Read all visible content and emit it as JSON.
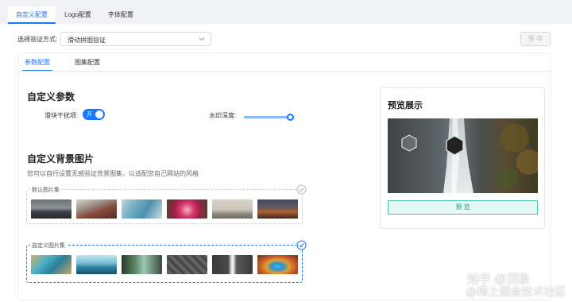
{
  "top_tabs": [
    {
      "label": "自定义配置",
      "active": true
    },
    {
      "label": "Logo配置",
      "active": false
    },
    {
      "label": "字体配置",
      "active": false
    }
  ],
  "verify": {
    "label": "选择验证方式:",
    "selected": "滑动拼图验证"
  },
  "save_label": "保 存",
  "sub_tabs": [
    {
      "label": "参数配置",
      "active": true
    },
    {
      "label": "图集配置",
      "active": false
    }
  ],
  "params": {
    "title": "自定义参数",
    "interference_label": "滑块干扰项:",
    "interference_toggle_text": "开",
    "interference_on": true,
    "watermark_label": "水印深度:",
    "watermark_depth_fraction": 0.92
  },
  "background": {
    "title": "自定义背景图片",
    "description": "您可以自行设置无感验证背景图集，以适配您自己网站的风格",
    "default_set_label": "默认图片集",
    "custom_set_label": "自定义图片集",
    "selected_set": "custom"
  },
  "preview": {
    "title": "预览展示",
    "button_label": "预 览"
  },
  "watermark_overlay": {
    "line1": "知乎 @顶象",
    "line2": "@稀土掘金技术社区"
  },
  "colors": {
    "accent": "#1677ff",
    "preview_button_border": "#4dc6b0",
    "preview_button_bg": "#e6f8f3"
  }
}
